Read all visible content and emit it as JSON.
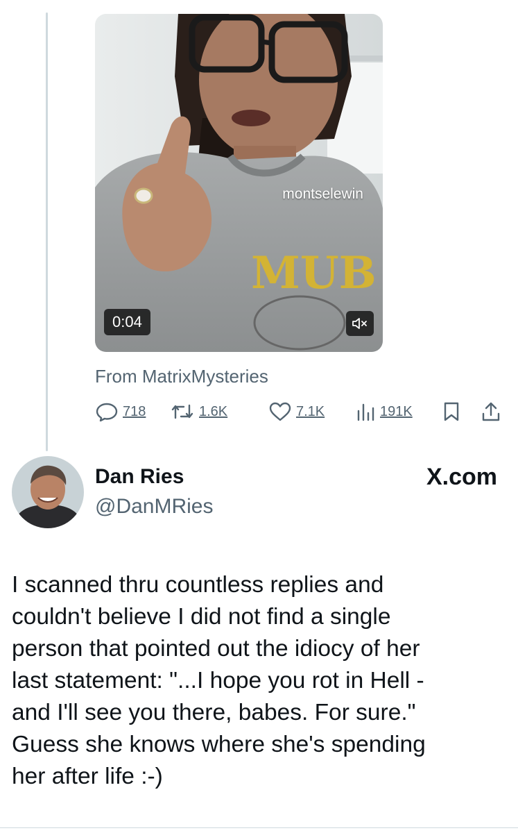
{
  "original_tweet": {
    "video": {
      "watermark": "montselewin",
      "duration": "0:04",
      "sweatshirt_print": "MUB",
      "mute_icon": "speaker-muted-icon"
    },
    "attribution": "From MatrixMysteries",
    "stats": {
      "replies": "718",
      "retweets": "1.6K",
      "likes": "7.1K",
      "views": "191K"
    }
  },
  "reply_tweet": {
    "author_name": "Dan Ries",
    "author_handle": "@DanMRies",
    "source": "X.com",
    "text_lines": [
      "I scanned thru countless replies and",
      "couldn't believe I did not find a single",
      "person that pointed out the idiocy of her",
      "last statement: \"...I hope you rot in Hell -",
      "and I'll see you there, babes. For sure.\"",
      "Guess she knows where she's spending",
      "her after life :-)"
    ]
  },
  "colors": {
    "text": "#0f1419",
    "secondary": "#536471",
    "thread_line": "#cfd9de"
  }
}
